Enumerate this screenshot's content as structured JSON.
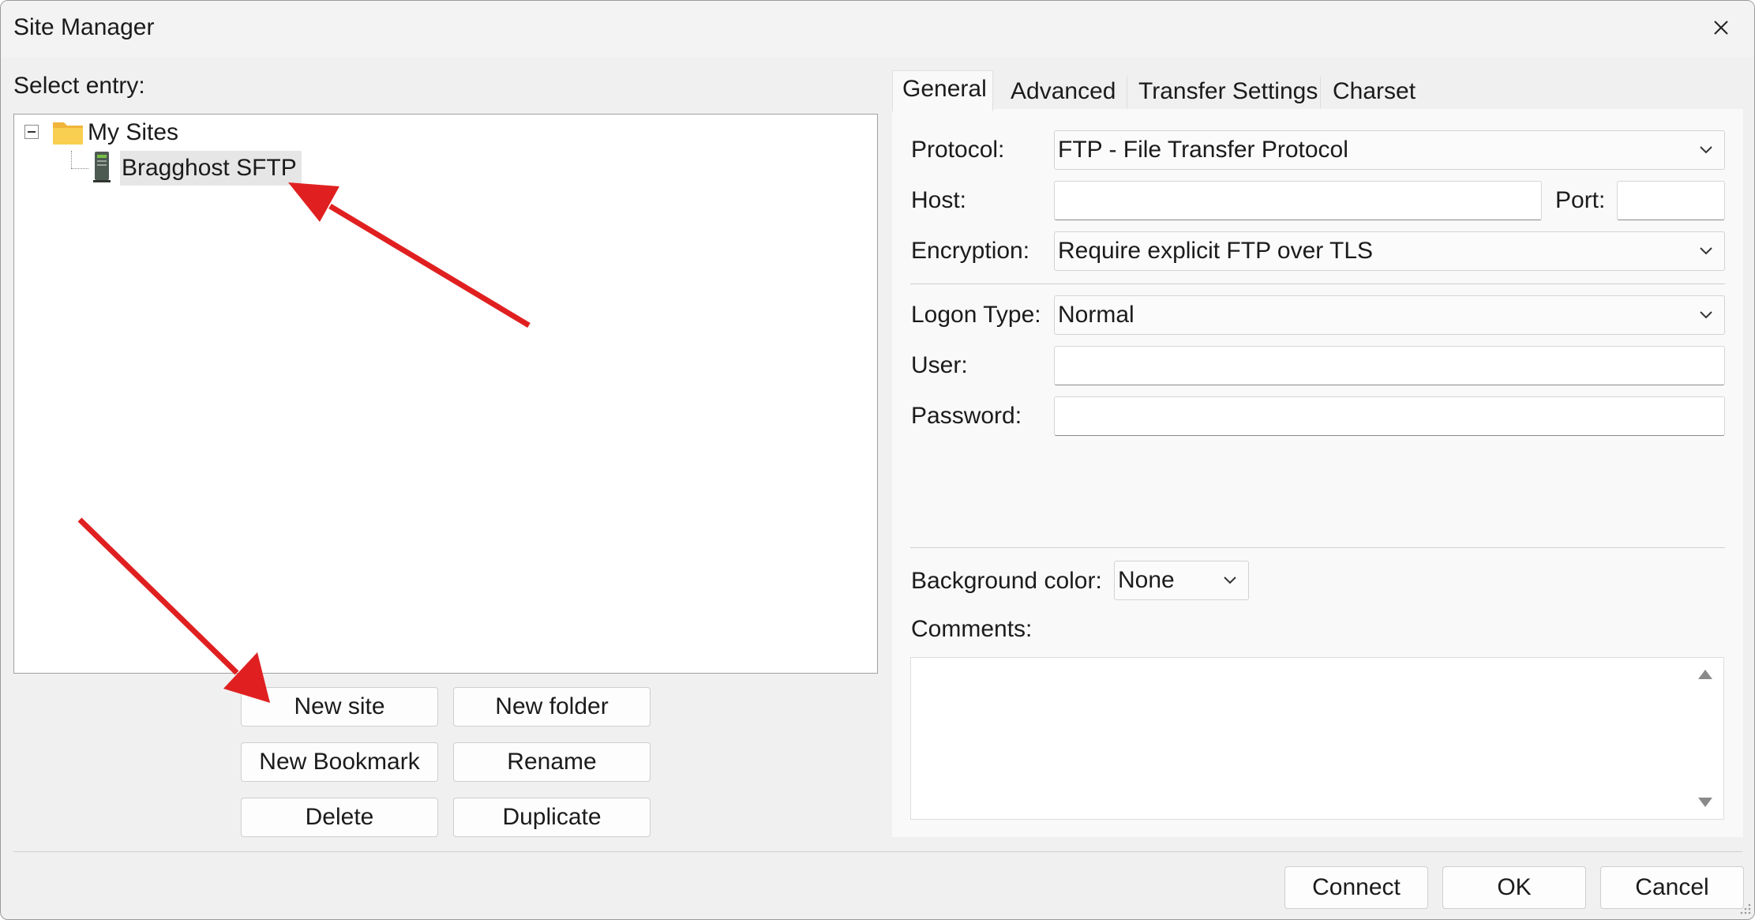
{
  "window": {
    "title": "Site Manager"
  },
  "left": {
    "select_entry_label": "Select entry:",
    "tree": {
      "root": {
        "label": "My Sites",
        "icon": "folder-icon"
      },
      "children": [
        {
          "label": "Bragghost SFTP",
          "icon": "server-icon"
        }
      ]
    },
    "buttons": {
      "new_site": "New site",
      "new_folder": "New folder",
      "new_bookmark": "New Bookmark",
      "rename": "Rename",
      "delete": "Delete",
      "duplicate": "Duplicate"
    }
  },
  "tabs": [
    "General",
    "Advanced",
    "Transfer Settings",
    "Charset"
  ],
  "general": {
    "protocol_label": "Protocol:",
    "protocol_value": "FTP - File Transfer Protocol",
    "host_label": "Host:",
    "host_value": "",
    "port_label": "Port:",
    "port_value": "",
    "encryption_label": "Encryption:",
    "encryption_value": "Require explicit FTP over TLS",
    "logon_type_label": "Logon Type:",
    "logon_type_value": "Normal",
    "user_label": "User:",
    "user_value": "",
    "password_label": "Password:",
    "password_value": "",
    "background_color_label": "Background color:",
    "background_color_value": "None",
    "comments_label": "Comments:",
    "comments_value": ""
  },
  "footer": {
    "connect": "Connect",
    "ok": "OK",
    "cancel": "Cancel"
  },
  "colors": {
    "window_bg": "#f0f0f0",
    "annotation_arrow": "#e02020",
    "folder": "#f5c342"
  }
}
